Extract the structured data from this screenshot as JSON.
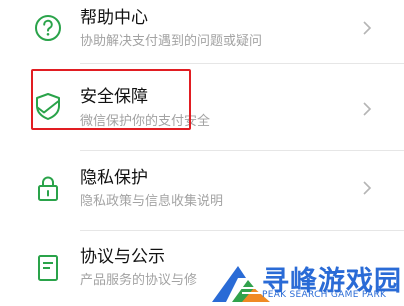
{
  "colors": {
    "icon_green": "#2aa34a",
    "highlight_red": "#e11d22",
    "title_text": "#111111",
    "subtitle_text": "#a3a3a3",
    "watermark_blue": "#2a6bd6"
  },
  "menu": {
    "items": [
      {
        "title": "帮助中心",
        "subtitle": "协助解决支付遇到的问题或疑问",
        "icon": "question-circle-icon"
      },
      {
        "title": "安全保障",
        "subtitle": "微信保护你的支付安全",
        "icon": "shield-check-icon"
      },
      {
        "title": "隐私保护",
        "subtitle": "隐私政策与信息收集说明",
        "icon": "lock-icon"
      },
      {
        "title": "协议与公示",
        "subtitle": "产品服务的协议与修",
        "icon": "document-icon"
      }
    ]
  },
  "watermark": {
    "title": "寻峰游戏园",
    "subtitle": "PEAK SEARCH GAME PARK"
  }
}
